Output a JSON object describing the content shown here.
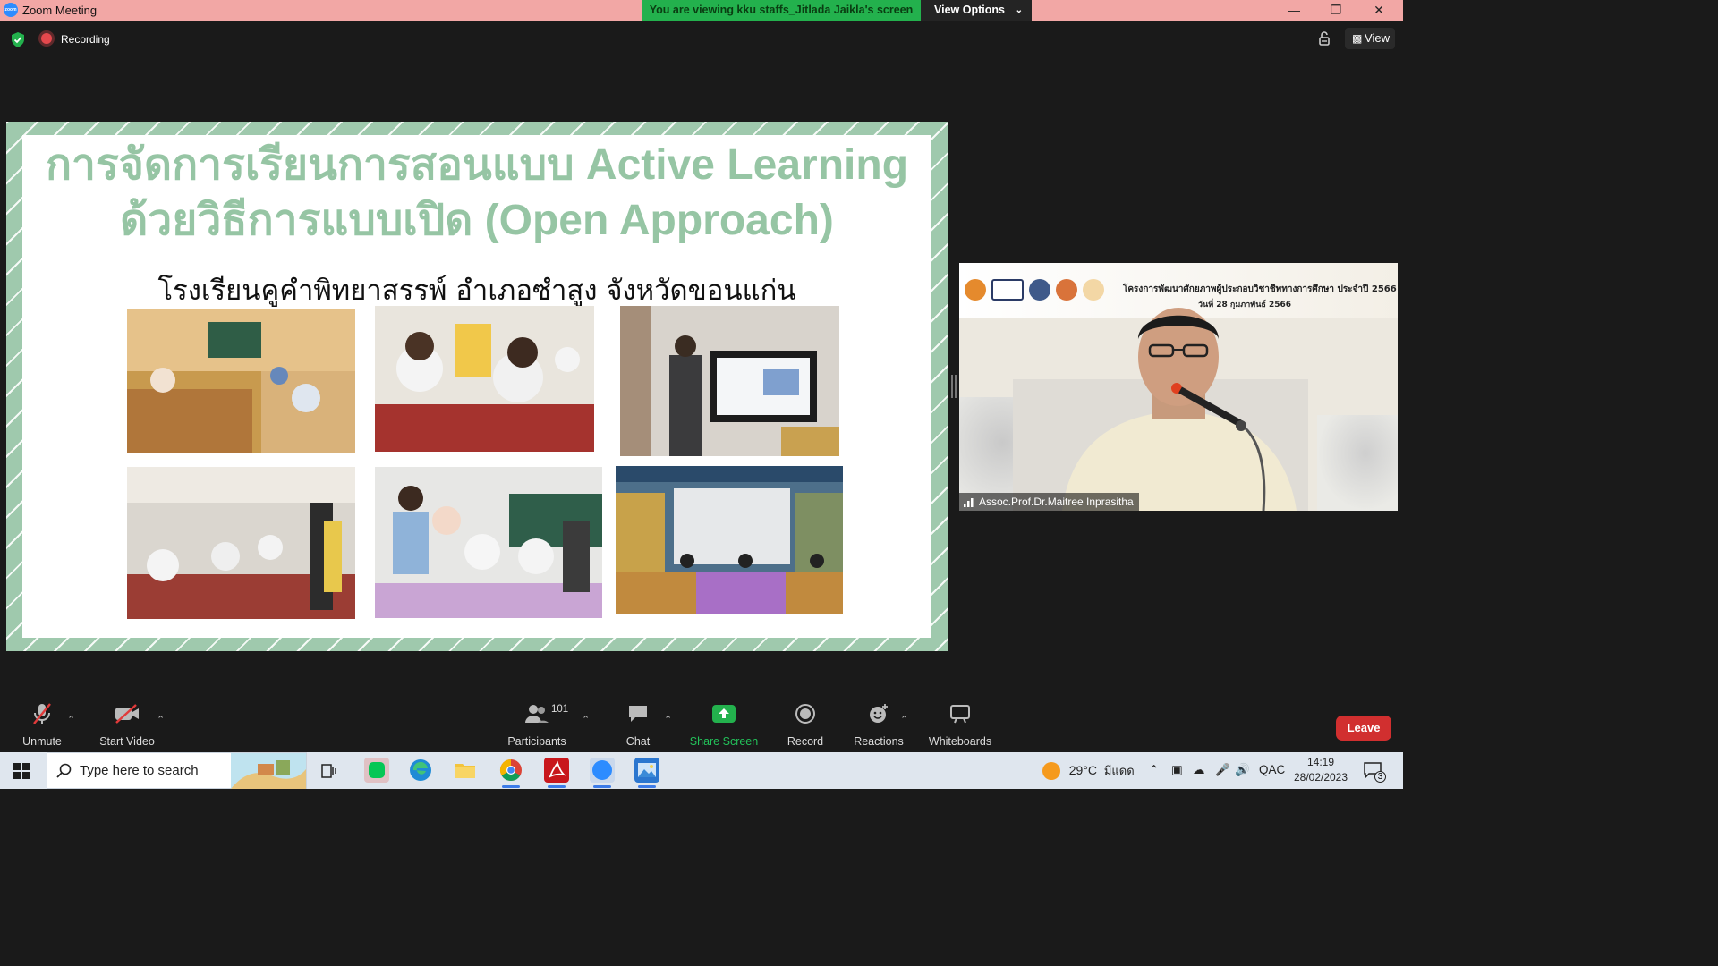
{
  "window": {
    "title": "Zoom Meeting",
    "viewing_banner": "You are viewing kku staffs_Jitlada Jaikla's screen",
    "view_options_label": "View Options"
  },
  "topbar": {
    "recording_label": "Recording",
    "view_label": "View"
  },
  "slide": {
    "title_line1": "การจัดการเรียนการสอนแบบ Active Learning",
    "title_line2": "ด้วยวิธีการแบบเปิด (Open Approach)",
    "subtitle": "โรงเรียนคูคำพิทยาสรรพ์  อำเภอซำสูง จังหวัดขอนแก่น"
  },
  "video": {
    "participant_name": "Assoc.Prof.Dr.Maitree Inprasitha",
    "banner_line1": "โครงการพัฒนาศักยภาพผู้ประกอบวิชาชีพทางการศึกษา ประจำปี 2566",
    "banner_line2": "วันที่ 28 กุมภาพันธ์ 2566"
  },
  "toolbar": {
    "unmute": "Unmute",
    "start_video": "Start Video",
    "participants": "Participants",
    "participants_count": "101",
    "chat": "Chat",
    "share_screen": "Share Screen",
    "record": "Record",
    "reactions": "Reactions",
    "whiteboards": "Whiteboards",
    "leave": "Leave"
  },
  "taskbar": {
    "search_placeholder": "Type here to search",
    "temperature": "29°C",
    "weather_text": "มีแดด",
    "ime": "QAC",
    "time": "14:19",
    "date": "28/02/2023",
    "notification_count": "3"
  },
  "colors": {
    "titlebar": "#f2a7a5",
    "banner_green": "#23b14d",
    "slide_green": "#96c5a4",
    "leave_red": "#d12f2f",
    "share_green": "#23b14d"
  }
}
